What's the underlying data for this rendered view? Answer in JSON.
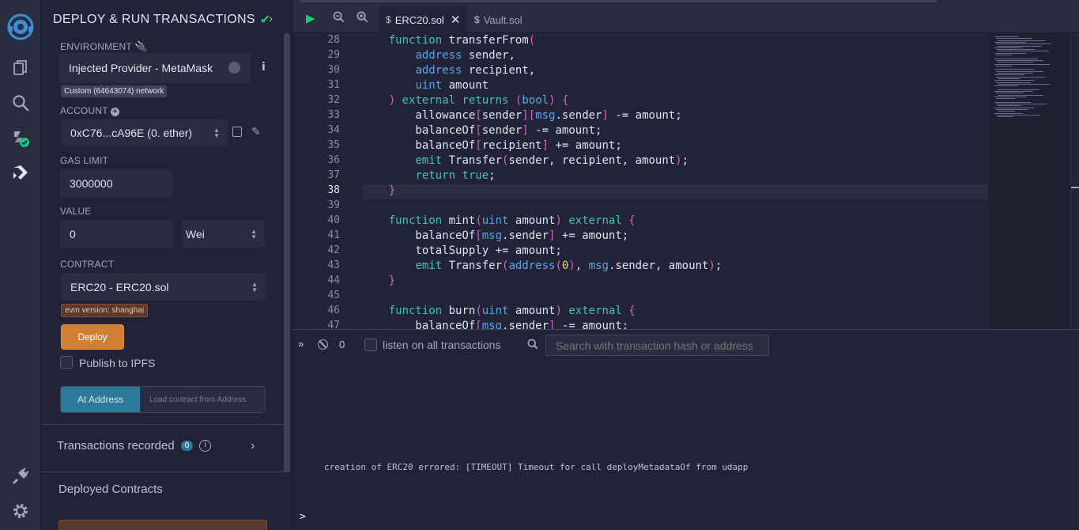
{
  "panel": {
    "title": "DEPLOY & RUN TRANSACTIONS",
    "environment_label": "ENVIRONMENT",
    "environment_value": "Injected Provider - MetaMask",
    "network_badge": "Custom (64643074) network",
    "account_label": "ACCOUNT",
    "account_value": "0xC76...cA96E (0. ether)",
    "gas_limit_label": "GAS LIMIT",
    "gas_limit_value": "3000000",
    "value_label": "VALUE",
    "value_amount": "0",
    "value_unit": "Wei",
    "contract_label": "CONTRACT",
    "contract_value": "ERC20 - ERC20.sol",
    "evm_badge": "evm version: shanghai",
    "deploy_label": "Deploy",
    "publish_label": "Publish to IPFS",
    "at_address_label": "At Address",
    "at_address_placeholder": "Load contract from Address",
    "transactions_recorded_label": "Transactions recorded",
    "transactions_count": "0",
    "deployed_contracts_label": "Deployed Contracts"
  },
  "tabs": [
    {
      "label": "ERC20.sol",
      "active": true
    },
    {
      "label": "Vault.sol",
      "active": false
    }
  ],
  "editor": {
    "current_line": 38,
    "lines": [
      {
        "n": "28",
        "code": "    function transferFrom("
      },
      {
        "n": "29",
        "code": "        address sender,"
      },
      {
        "n": "30",
        "code": "        address recipient,"
      },
      {
        "n": "31",
        "code": "        uint amount"
      },
      {
        "n": "32",
        "code": "    ) external returns (bool) {"
      },
      {
        "n": "33",
        "code": "        allowance[sender][msg.sender] -= amount;"
      },
      {
        "n": "34",
        "code": "        balanceOf[sender] -= amount;"
      },
      {
        "n": "35",
        "code": "        balanceOf[recipient] += amount;"
      },
      {
        "n": "36",
        "code": "        emit Transfer(sender, recipient, amount);"
      },
      {
        "n": "37",
        "code": "        return true;"
      },
      {
        "n": "38",
        "code": "    }"
      },
      {
        "n": "39",
        "code": ""
      },
      {
        "n": "40",
        "code": "    function mint(uint amount) external {"
      },
      {
        "n": "41",
        "code": "        balanceOf[msg.sender] += amount;"
      },
      {
        "n": "42",
        "code": "        totalSupply += amount;"
      },
      {
        "n": "43",
        "code": "        emit Transfer(address(0), msg.sender, amount);"
      },
      {
        "n": "44",
        "code": "    }"
      },
      {
        "n": "45",
        "code": ""
      },
      {
        "n": "46",
        "code": "    function burn(uint amount) external {"
      },
      {
        "n": "47",
        "code": "        balanceOf[msg.sender] -= amount;"
      }
    ]
  },
  "terminal": {
    "count": "0",
    "listen_label": "listen on all transactions",
    "search_placeholder": "Search with transaction hash or address",
    "message": "creation of ERC20 errored: [TIMEOUT] Timeout for call deployMetadataOf from udapp",
    "prompt": ">"
  },
  "colors": {
    "background": "#222336",
    "panel": "#2a2c3f",
    "deploy_button": "#d07f35",
    "at_address_button": "#2a7a9a",
    "success": "#1ec97a"
  }
}
